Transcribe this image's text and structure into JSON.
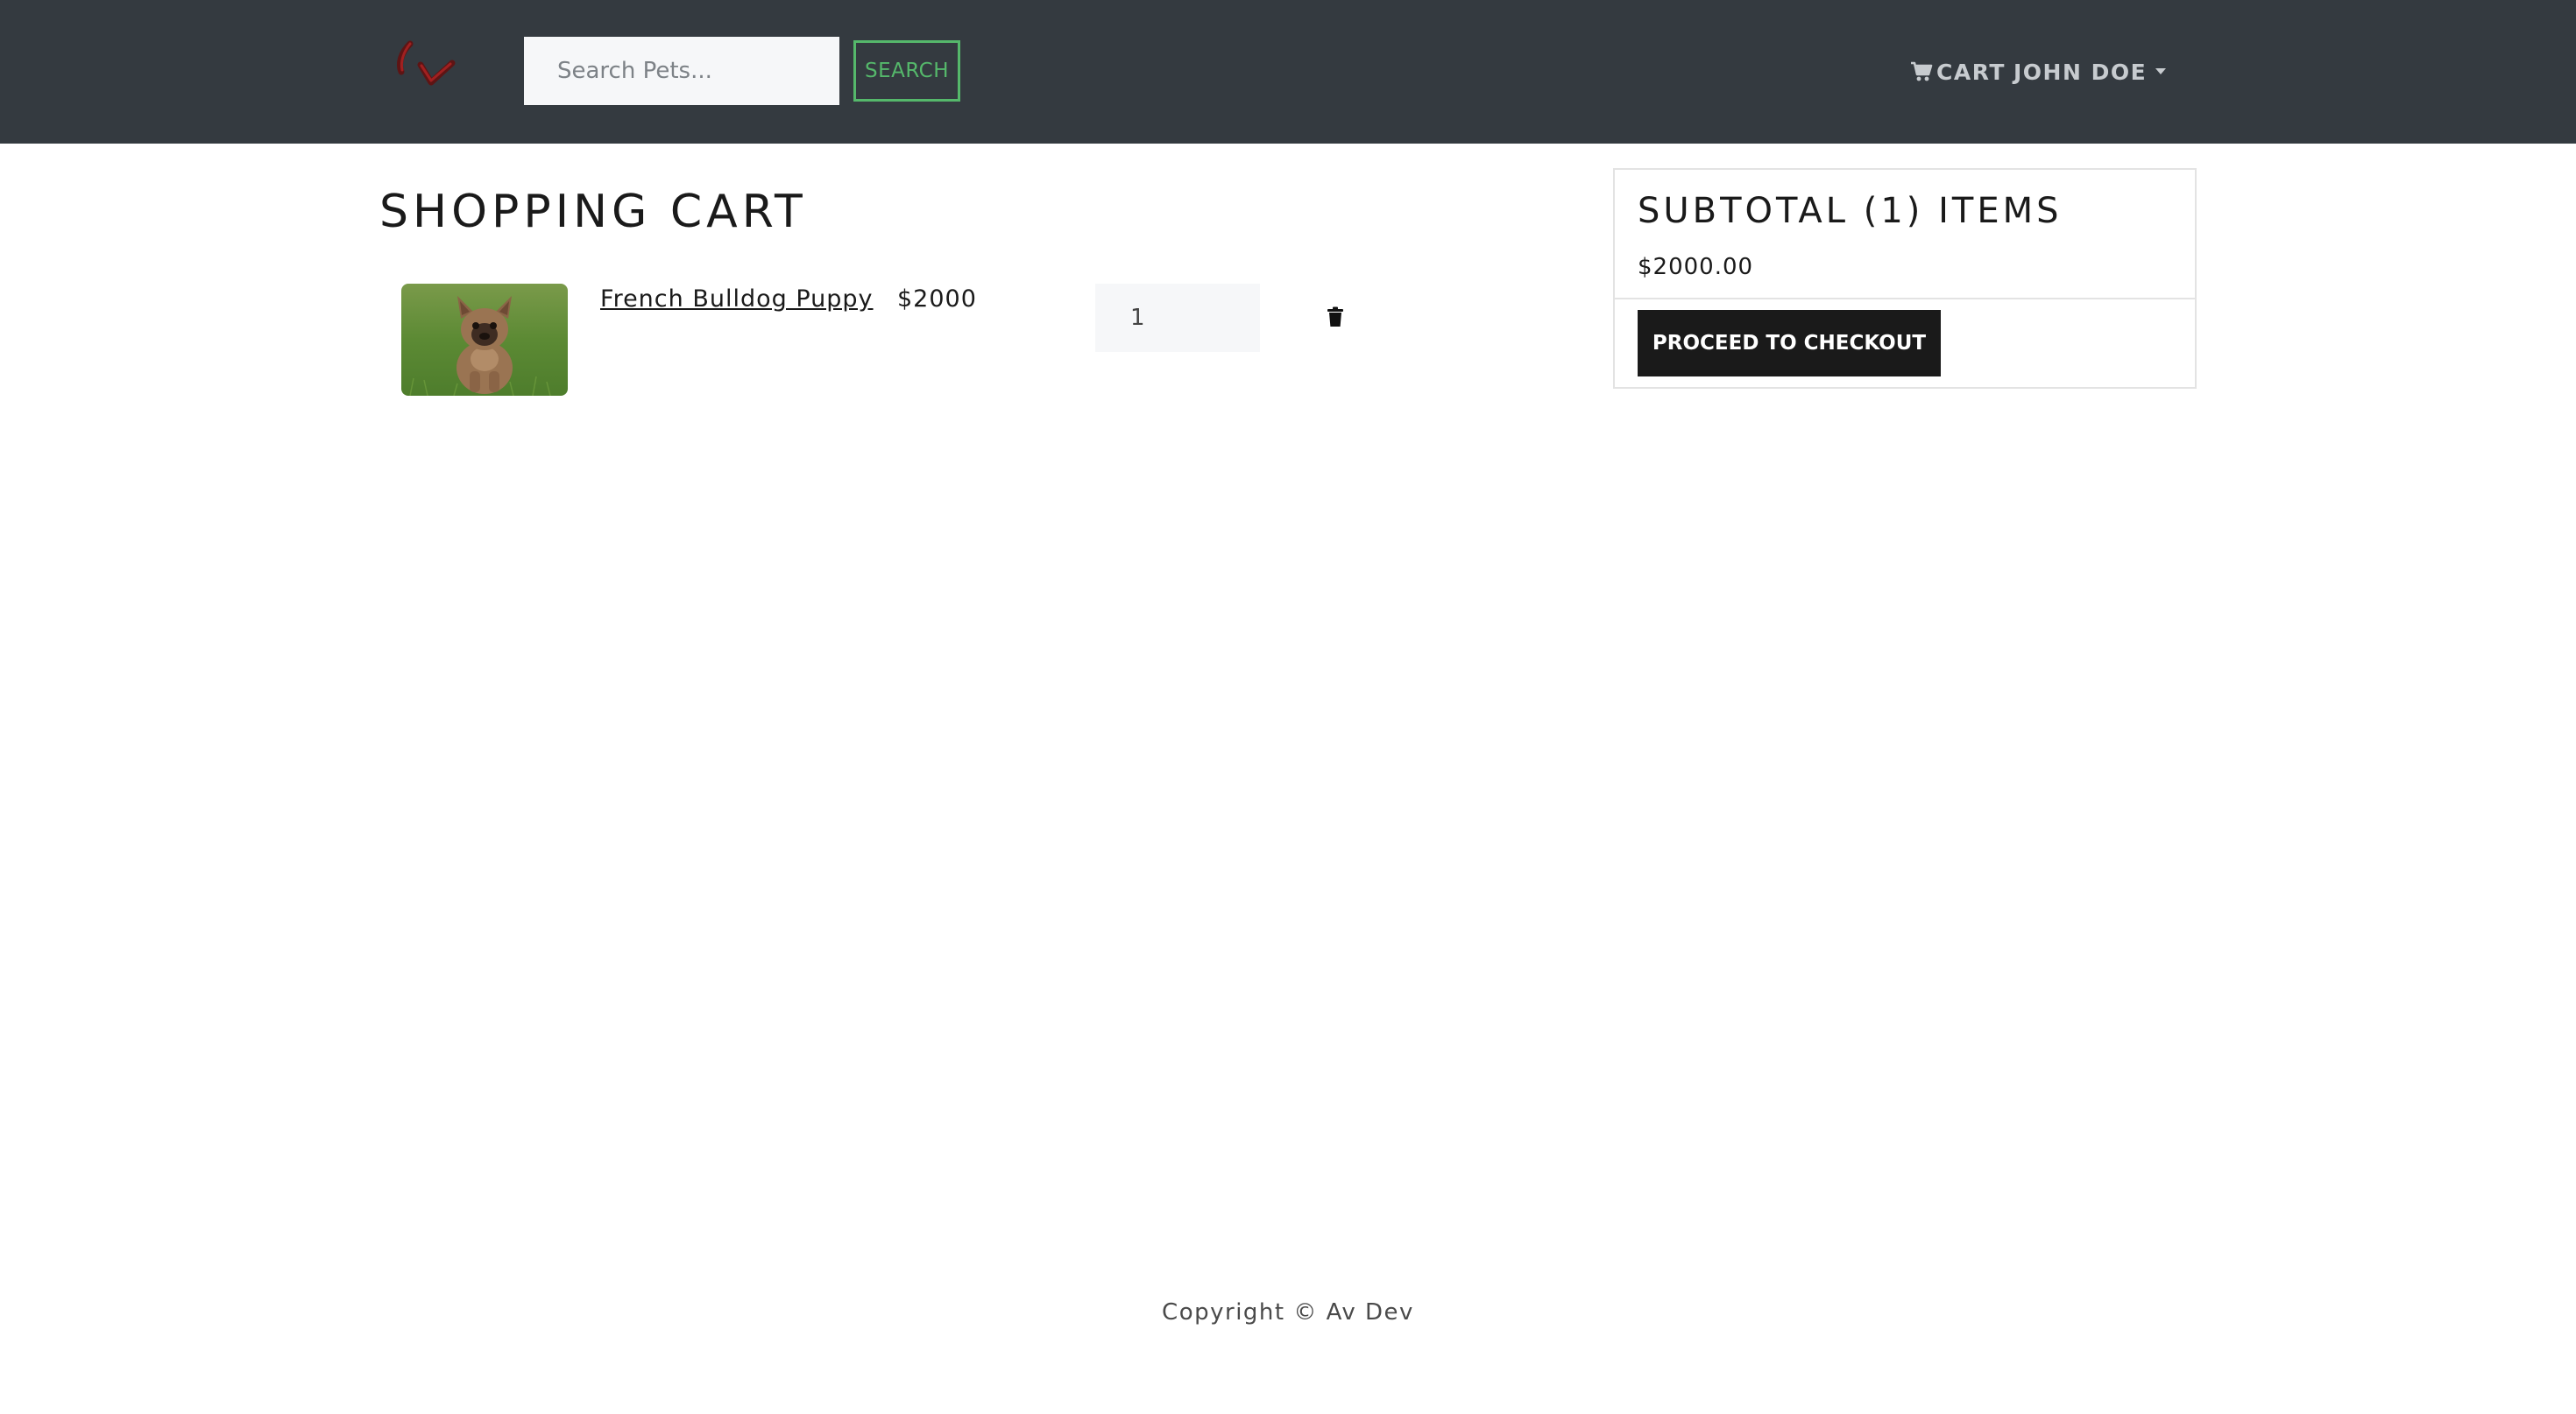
{
  "navbar": {
    "logo_icon": "brand-logo-icon",
    "search": {
      "placeholder": "Search Pets...",
      "value": "",
      "button_label": "SEARCH"
    },
    "cart_label": "CART",
    "cart_icon": "shopping-cart-icon",
    "user_name": "JOHN DOE",
    "colors": {
      "background": "#343a40",
      "search_accent": "#55b86b"
    }
  },
  "cart": {
    "title": "SHOPPING CART",
    "items": [
      {
        "name": "French Bulldog Puppy",
        "price": "$2000",
        "quantity": "1",
        "image_icon": "french-bulldog-photo",
        "delete_icon": "trash-icon"
      }
    ]
  },
  "summary": {
    "title": "SUBTOTAL (1) ITEMS",
    "total": "$2000.00",
    "checkout_label": "PROCEED TO CHECKOUT"
  },
  "footer": {
    "text": "Copyright © Av Dev"
  }
}
